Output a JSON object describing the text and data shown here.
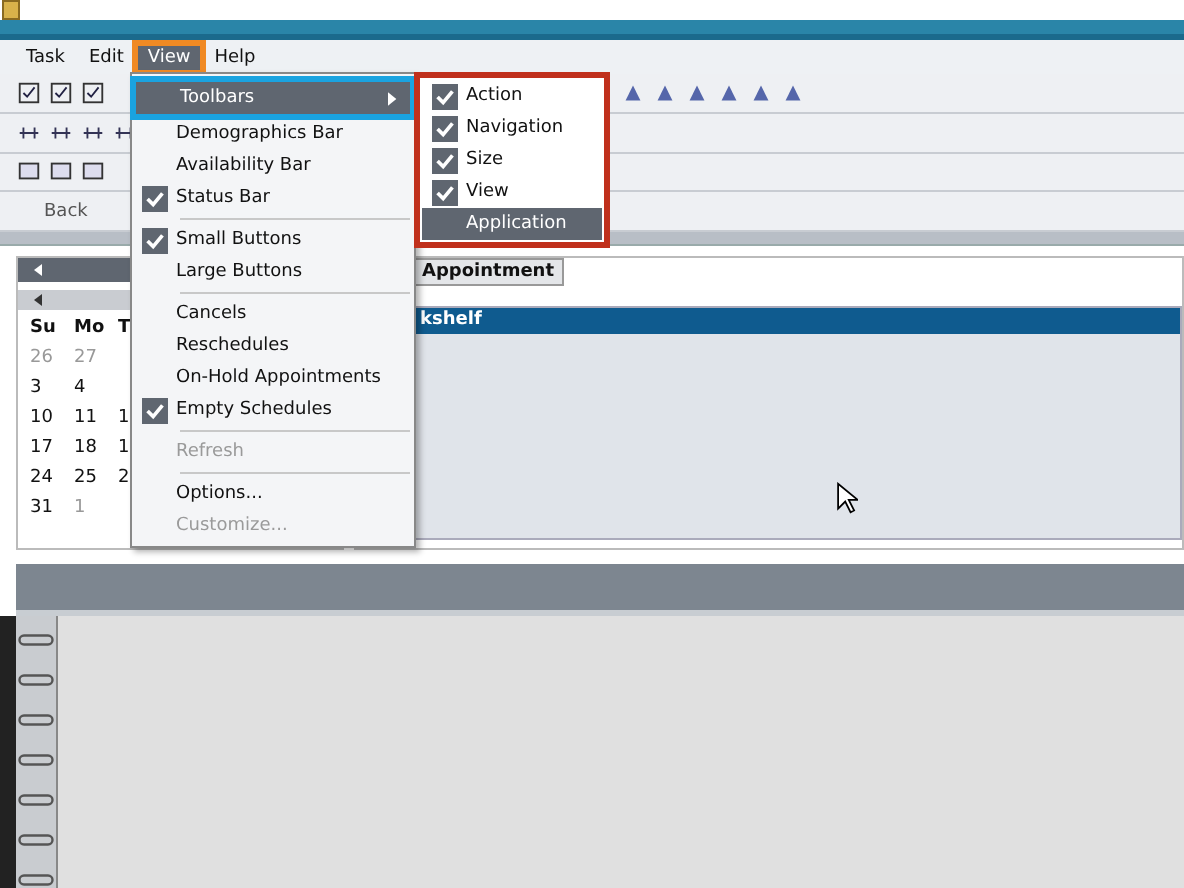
{
  "menubar": [
    {
      "label": "Task",
      "selected": false
    },
    {
      "label": "Edit",
      "selected": false
    },
    {
      "label": "View",
      "selected": true
    },
    {
      "label": "Help",
      "selected": false
    }
  ],
  "toolbar": {
    "back_label": "Back"
  },
  "calendar": {
    "weekdays": [
      "Su",
      "Mo",
      "T"
    ],
    "weeks": [
      [
        {
          "day": "26",
          "other_month": true
        },
        {
          "day": "27",
          "other_month": true
        }
      ],
      [
        {
          "day": "3",
          "other_month": false
        },
        {
          "day": "4",
          "other_month": false
        }
      ],
      [
        {
          "day": "10",
          "other_month": false
        },
        {
          "day": "11",
          "other_month": false
        },
        {
          "day": "1",
          "other_month": false
        }
      ],
      [
        {
          "day": "17",
          "other_month": false
        },
        {
          "day": "18",
          "other_month": false
        },
        {
          "day": "1",
          "other_month": false
        }
      ],
      [
        {
          "day": "24",
          "other_month": false
        },
        {
          "day": "25",
          "other_month": false
        },
        {
          "day": "2",
          "other_month": false
        }
      ],
      [
        {
          "day": "31",
          "other_month": false
        },
        {
          "day": "1",
          "other_month": true
        }
      ]
    ]
  },
  "tabs": [
    {
      "label": "Appointment",
      "selected": true
    }
  ],
  "pane_header": "kshelf",
  "view_menu": [
    {
      "kind": "item",
      "label": "Toolbars",
      "checked": false,
      "disabled": false,
      "submenu": true,
      "selected": true
    },
    {
      "kind": "item",
      "label": "Demographics Bar",
      "checked": false,
      "disabled": false,
      "submenu": false,
      "selected": false
    },
    {
      "kind": "item",
      "label": "Availability Bar",
      "checked": false,
      "disabled": false,
      "submenu": false,
      "selected": false
    },
    {
      "kind": "item",
      "label": "Status Bar",
      "checked": true,
      "disabled": false,
      "submenu": false,
      "selected": false
    },
    {
      "kind": "separator"
    },
    {
      "kind": "item",
      "label": "Small Buttons",
      "checked": true,
      "disabled": false,
      "submenu": false,
      "selected": false
    },
    {
      "kind": "item",
      "label": "Large Buttons",
      "checked": false,
      "disabled": false,
      "submenu": false,
      "selected": false
    },
    {
      "kind": "separator"
    },
    {
      "kind": "item",
      "label": "Cancels",
      "checked": false,
      "disabled": false,
      "submenu": false,
      "selected": false
    },
    {
      "kind": "item",
      "label": "Reschedules",
      "checked": false,
      "disabled": false,
      "submenu": false,
      "selected": false
    },
    {
      "kind": "item",
      "label": "On-Hold Appointments",
      "checked": false,
      "disabled": false,
      "submenu": false,
      "selected": false
    },
    {
      "kind": "item",
      "label": "Empty Schedules",
      "checked": true,
      "disabled": false,
      "submenu": false,
      "selected": false
    },
    {
      "kind": "separator"
    },
    {
      "kind": "item",
      "label": "Refresh",
      "checked": false,
      "disabled": true,
      "submenu": false,
      "selected": false
    },
    {
      "kind": "separator"
    },
    {
      "kind": "item",
      "label": "Options...",
      "checked": false,
      "disabled": false,
      "submenu": false,
      "selected": false
    },
    {
      "kind": "item",
      "label": "Customize...",
      "checked": false,
      "disabled": true,
      "submenu": false,
      "selected": false
    }
  ],
  "toolbars_submenu": [
    {
      "label": "Action",
      "checked": true,
      "selected": false
    },
    {
      "label": "Navigation",
      "checked": true,
      "selected": false
    },
    {
      "label": "Size",
      "checked": true,
      "selected": false
    },
    {
      "label": "View",
      "checked": true,
      "selected": false
    },
    {
      "label": "Application",
      "checked": false,
      "selected": true
    }
  ]
}
